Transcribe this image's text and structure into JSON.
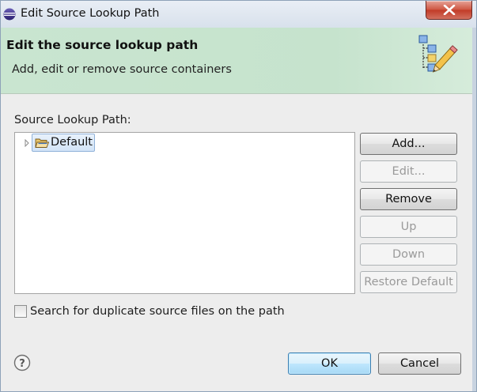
{
  "window": {
    "title": "Edit Source Lookup Path",
    "close_label": "Close"
  },
  "header": {
    "title": "Edit the source lookup path",
    "description": "Add, edit or remove source containers"
  },
  "source_list": {
    "label": "Source Lookup Path:",
    "items": [
      {
        "label": "Default",
        "selected": true,
        "expanded": false,
        "icon": "folder-open-icon"
      }
    ]
  },
  "side_buttons": {
    "add": "Add...",
    "edit": "Edit...",
    "remove": "Remove",
    "up": "Up",
    "down": "Down",
    "restore": "Restore Default"
  },
  "options": {
    "search_duplicates_label": "Search for duplicate source files on the path",
    "search_duplicates_checked": false
  },
  "footer": {
    "help_label": "?",
    "ok": "OK",
    "cancel": "Cancel"
  },
  "colors": {
    "header_bg": "#c9e5d0",
    "close_red": "#c13b27",
    "selection_bg": "#d3e4f7",
    "ok_border": "#3c7fb1"
  }
}
